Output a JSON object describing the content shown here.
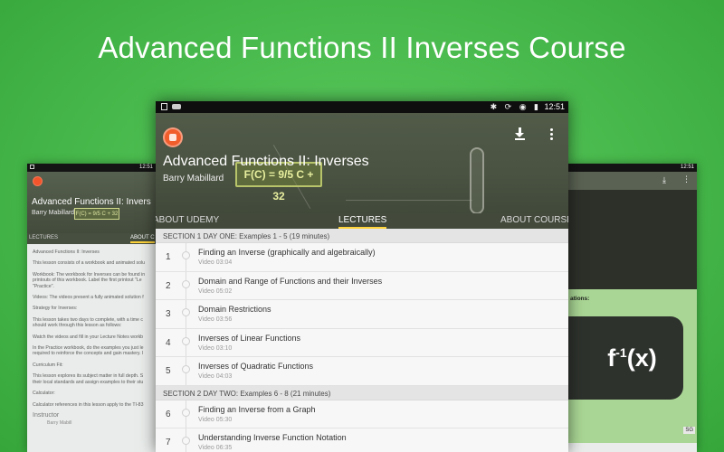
{
  "headline": "Advanced Functions II Inverses Course",
  "status_bar": {
    "time": "12:51"
  },
  "course": {
    "title": "Advanced Functions II: Inverses",
    "author": "Barry Mabillard",
    "formula": "F(C) = 9/5 C + 32"
  },
  "tabs": [
    {
      "label": "ABOUT UDEMY",
      "active": false
    },
    {
      "label": "LECTURES",
      "active": true
    },
    {
      "label": "ABOUT COURSE",
      "active": false
    }
  ],
  "sections": [
    {
      "header": "SECTION 1   DAY ONE: Examples 1 - 5 (19 minutes)",
      "lectures": [
        {
          "num": "1",
          "title": "Finding an Inverse (graphically and algebraically)",
          "sub": "Video 03:04"
        },
        {
          "num": "2",
          "title": "Domain and Range of Functions and their Inverses",
          "sub": "Video 05:02"
        },
        {
          "num": "3",
          "title": "Domain Restrictions",
          "sub": "Video 03:56"
        },
        {
          "num": "4",
          "title": "Inverses of Linear Functions",
          "sub": "Video 03:10"
        },
        {
          "num": "5",
          "title": "Inverses of Quadratic Functions",
          "sub": "Video 04:03"
        }
      ]
    },
    {
      "header": "SECTION 2   DAY TWO: Examples 6 - 8 (21 minutes)",
      "lectures": [
        {
          "num": "6",
          "title": "Finding an Inverse from a Graph",
          "sub": "Video 05:30"
        },
        {
          "num": "7",
          "title": "Understanding Inverse Function Notation",
          "sub": "Video 06:35"
        }
      ]
    }
  ],
  "left_phone": {
    "time": "12:51",
    "title": "Advanced Functions II: Invers",
    "author": "Barry Mabillard",
    "formula": "F(C) = 9/5 C + 32",
    "tab_left": "LECTURES",
    "tab_right": "ABOUT C",
    "paragraphs": [
      "Advanced Functions II: Inverses",
      "This lesson consists of a workbook and animated solu",
      "Workbook: The workbook for Inverses can be found in",
      "printouts of this workbook. Label the first printout \"Le",
      "\"Practice\".",
      "Videos: The videos present a fully animated solution f",
      "Strategy for Inverses:",
      "This lesson takes two days to complete, with a time c",
      "should work through this lesson as follows:",
      "Watch the videos and fill in your Lecture Notes workb",
      "In the Practice workbook, do the examples you just le",
      "required to reinforce the concepts and gain mastery. I",
      "Curriculum Fit:",
      "This lesson explores its subject matter in full depth. S",
      "their local standards and assign examples to their stu",
      "Calculator:",
      "Calculator references in this lesson apply to the TI-83"
    ],
    "instructor_heading": "Instructor",
    "instructor_name": "Barry Mabill"
  },
  "right_phone": {
    "time": "12:51",
    "label": "ations:",
    "fx_base": "f",
    "fx_sup": "-1",
    "fx_arg": "(x)",
    "logo": "SG"
  }
}
